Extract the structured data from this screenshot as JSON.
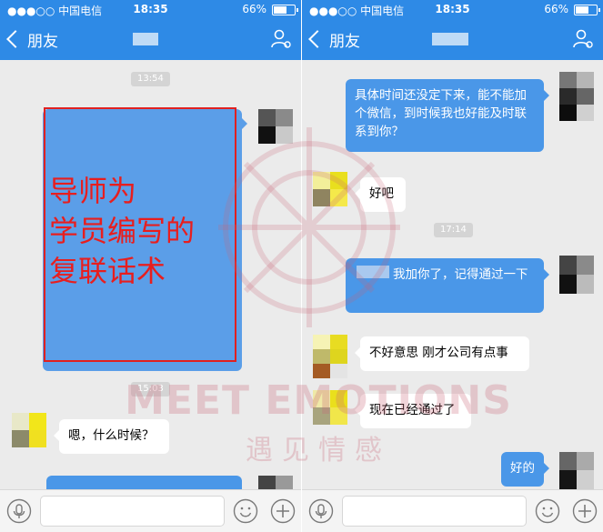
{
  "status": {
    "carrier": "●●●○○ 中国电信",
    "time": "18:35",
    "battery": "66%"
  },
  "nav": {
    "back_label": "朋友"
  },
  "left": {
    "timestamps": [
      "13:54",
      "15:03"
    ],
    "overlay_lines": [
      "导师为",
      "学员编写的",
      "复联话术"
    ],
    "messages": [
      {
        "text": "嗯，什么时候？"
      }
    ]
  },
  "right": {
    "timestamps": [
      "17:14"
    ],
    "messages": [
      {
        "text": "具体时间还没定下来，能不能加个微信，到时候我也好能及时联系到你？"
      },
      {
        "text": "好吧"
      },
      {
        "text": "我加你了，记得通过一下"
      },
      {
        "text": "不好意思 刚才公司有点事"
      },
      {
        "text": "现在已经通过了"
      },
      {
        "text": "好的"
      }
    ]
  },
  "watermark": {
    "line1": "MEET EMOTIONS",
    "line2": "遇见情感"
  },
  "icons": {
    "back": "chevron-left-icon",
    "profile": "profile-settings-icon",
    "voice": "voice-icon",
    "emoji": "emoji-icon",
    "plus": "plus-icon"
  },
  "colors": {
    "bar": "#2e8ae6",
    "bubble_out": "#4a97e8",
    "highlight": "#e02020"
  }
}
